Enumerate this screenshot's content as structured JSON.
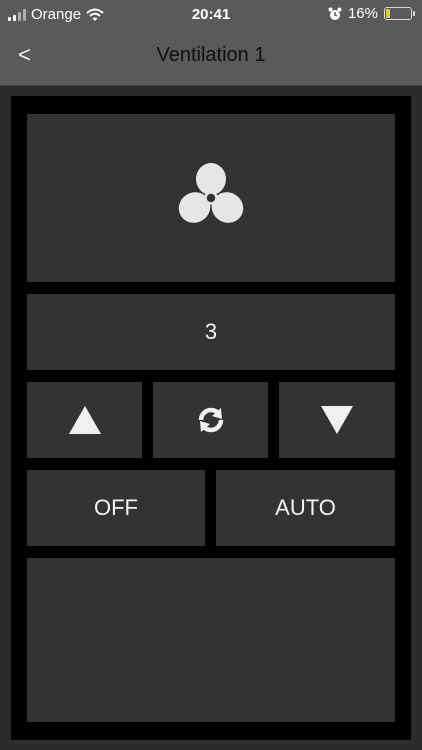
{
  "status_bar": {
    "carrier": "Orange",
    "time": "20:41",
    "battery_percent": "16%",
    "battery_level": 0.16,
    "icons": [
      "signal-icon",
      "wifi-icon",
      "alarm-icon",
      "battery-icon"
    ]
  },
  "header": {
    "back_label": "<",
    "title": "Ventilation 1"
  },
  "ventilation": {
    "fan_icon": "fan-icon",
    "speed": "3",
    "up_icon": "arrow-up-icon",
    "refresh_icon": "refresh-icon",
    "down_icon": "arrow-down-icon",
    "off_label": "OFF",
    "auto_label": "AUTO"
  },
  "colors": {
    "bar_background": "#5a5a5a",
    "panel_background": "#000000",
    "tile_background": "#333333",
    "battery_fill": "#f3c623"
  }
}
